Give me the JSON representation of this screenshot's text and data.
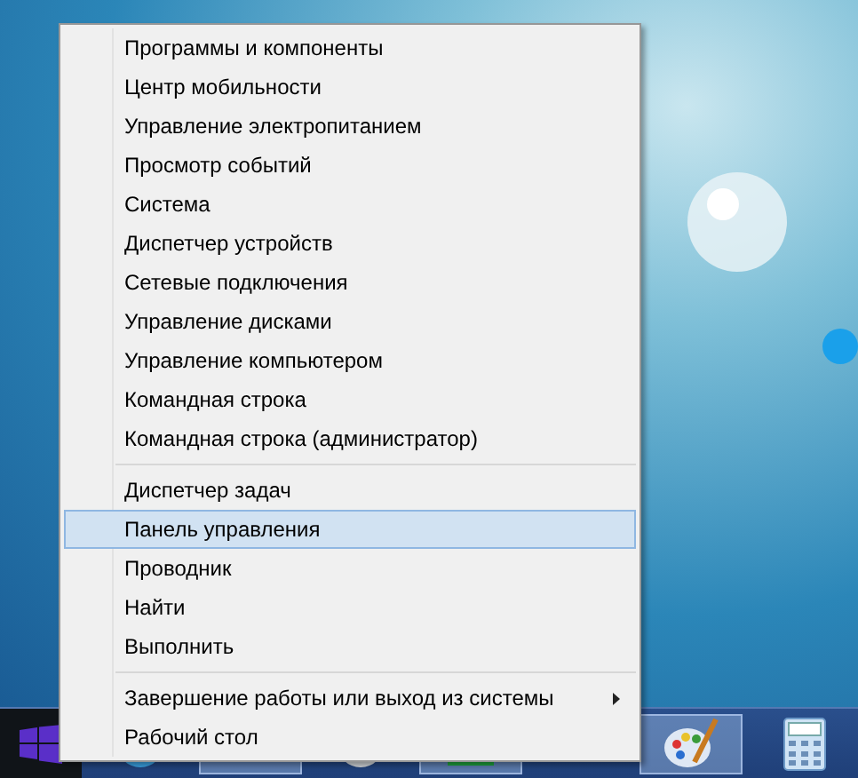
{
  "context_menu": {
    "groups": [
      {
        "items": [
          {
            "label": "Программы и компоненты",
            "selected": false,
            "has_submenu": false
          },
          {
            "label": "Центр мобильности",
            "selected": false,
            "has_submenu": false
          },
          {
            "label": "Управление электропитанием",
            "selected": false,
            "has_submenu": false
          },
          {
            "label": "Просмотр событий",
            "selected": false,
            "has_submenu": false
          },
          {
            "label": "Система",
            "selected": false,
            "has_submenu": false
          },
          {
            "label": "Диспетчер устройств",
            "selected": false,
            "has_submenu": false
          },
          {
            "label": "Сетевые подключения",
            "selected": false,
            "has_submenu": false
          },
          {
            "label": "Управление дисками",
            "selected": false,
            "has_submenu": false
          },
          {
            "label": "Управление компьютером",
            "selected": false,
            "has_submenu": false
          },
          {
            "label": "Командная строка",
            "selected": false,
            "has_submenu": false
          },
          {
            "label": "Командная строка (администратор)",
            "selected": false,
            "has_submenu": false
          }
        ]
      },
      {
        "items": [
          {
            "label": "Диспетчер задач",
            "selected": false,
            "has_submenu": false
          },
          {
            "label": "Панель управления",
            "selected": true,
            "has_submenu": false
          },
          {
            "label": "Проводник",
            "selected": false,
            "has_submenu": false
          },
          {
            "label": "Найти",
            "selected": false,
            "has_submenu": false
          },
          {
            "label": "Выполнить",
            "selected": false,
            "has_submenu": false
          }
        ]
      },
      {
        "items": [
          {
            "label": "Завершение работы или выход из системы",
            "selected": false,
            "has_submenu": true
          },
          {
            "label": "Рабочий стол",
            "selected": false,
            "has_submenu": false
          }
        ]
      }
    ]
  }
}
